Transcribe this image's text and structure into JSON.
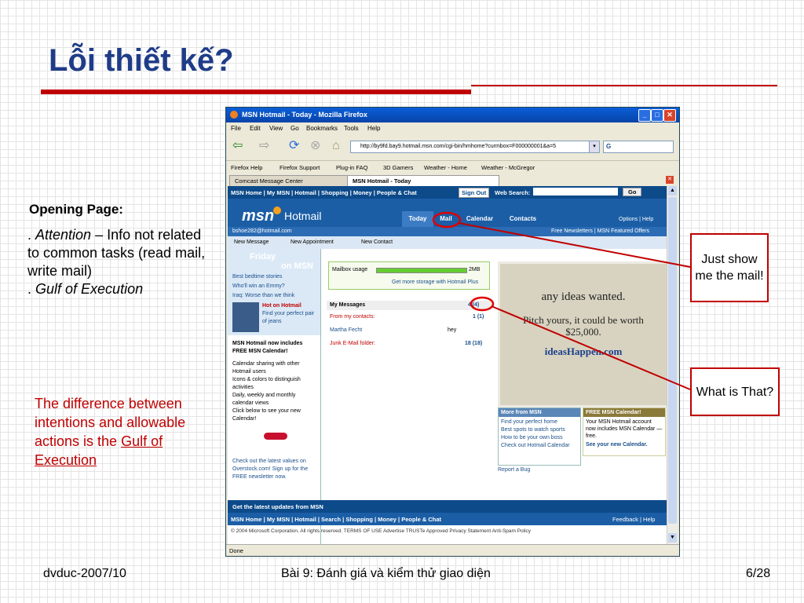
{
  "slide": {
    "title": "Lỗi thiết kế?",
    "opening_heading": "Opening Page:",
    "bullet1_lead": ".  ",
    "bullet1_em": "Attention",
    "bullet1_rest": " – Info not related to common tasks (read mail, write mail)",
    "bullet2_lead": ".  ",
    "bullet2_em": "Gulf of Execution",
    "gulf_text": "The difference between intentions and allowable actions is the ",
    "gulf_link": "Gulf of Execution",
    "callout1": "Just show me the mail!",
    "callout2": "What is That?",
    "footer_left": "dvduc-2007/10",
    "footer_center": "Bài 9: Đánh giá và kiểm thử giao diện",
    "footer_right": "6/28"
  },
  "browser": {
    "window_title": "MSN Hotmail - Today - Mozilla Firefox",
    "menus": [
      "File",
      "Edit",
      "View",
      "Go",
      "Bookmarks",
      "Tools",
      "Help"
    ],
    "url": "http://by9fd.bay9.hotmail.msn.com/cgi-bin/hmhome?curmbox=F000000001&a=5",
    "bookmarks": [
      "Firefox Help",
      "Firefox Support",
      "Plug-in FAQ",
      "3D Gamers",
      "Weather - Home",
      "Weather - McGregor"
    ],
    "tabs": [
      "Comcast Message Center",
      "MSN Hotmail - Today"
    ],
    "status": "Done"
  },
  "hotmail": {
    "topnav": "MSN Home  |  My MSN  |  Hotmail  |  Shopping  |  Money  |  People & Chat",
    "signout": "Sign Out",
    "web_search": "Web Search:",
    "go": "Go",
    "logo": "msn",
    "product": "Hotmail",
    "tabs": [
      "Today",
      "Mail",
      "Calendar",
      "Contacts"
    ],
    "options": "Options  |  Help",
    "user": "bshoe282@hotmail.com",
    "sub_right": "Free Newsletters  |  MSN Featured Offers",
    "actions": [
      "New Message",
      "New Appointment",
      "New Contact"
    ],
    "friday_title": "Friday",
    "friday_sub": "on MSN",
    "friday_links": [
      "Best bedtime stories",
      "Who'll win an Emmy?",
      "Iraq: Worse than we think"
    ],
    "hot_title": "Hot on Hotmail",
    "hot_text": "Find your perfect pair of jeans",
    "cal_heading": "MSN Hotmail now includes FREE MSN Calendar!",
    "cal_bullets": [
      "Calendar sharing with other Hotmail users",
      "Icons & colors to distinguish activities",
      "Daily, weekly and monthly calendar views",
      "Click below to see your new Calendar!"
    ],
    "overstock": "Check out the latest values on Overstock.com! Sign up for the FREE newsletter now.",
    "mailbox_usage": "Mailbox usage",
    "mailbox_size": "2MB",
    "more_storage": "Get more storage with Hotmail Plus",
    "my_messages": "My Messages",
    "my_messages_count": "4 (4)",
    "from_contacts": "From my contacts:",
    "from_contacts_count": "1 (1)",
    "sender": "Martha Fecht",
    "subject": "hey",
    "junk": "Junk E-Mail folder:",
    "junk_count": "18 (18)",
    "ad_line1": "any ideas wanted.",
    "ad_line2": "Pitch yours, it could be worth $25,000.",
    "ad_line3": "ideasHappen.com",
    "more_msn": "More from MSN",
    "more_links": [
      "Find your perfect home",
      "Best spots to watch sports",
      "How to be your own boss",
      "Check out Hotmail Calendar"
    ],
    "report_bug": "Report a Bug",
    "free_cal": "FREE MSN Calendar!",
    "free_cal_text": "Your MSN Hotmail account now includes MSN Calendar — free.",
    "free_cal_link": "See your new Calendar.",
    "updates": "Get the latest updates from MSN",
    "bottom_nav": "MSN Home  |  My MSN  |  Hotmail  |  Search  |  Shopping  |  Money  |  People & Chat",
    "bottom_right": "Feedback  |  Help",
    "copyright": "© 2004 Microsoft Corporation. All rights reserved.  TERMS OF USE   Advertise   TRUSTe Approved Privacy Statement      Anti-Spam Policy"
  },
  "colors": {
    "title_blue": "#1f3c88",
    "accent_red": "#c00000",
    "msn_blue": "#1b5ea6"
  }
}
